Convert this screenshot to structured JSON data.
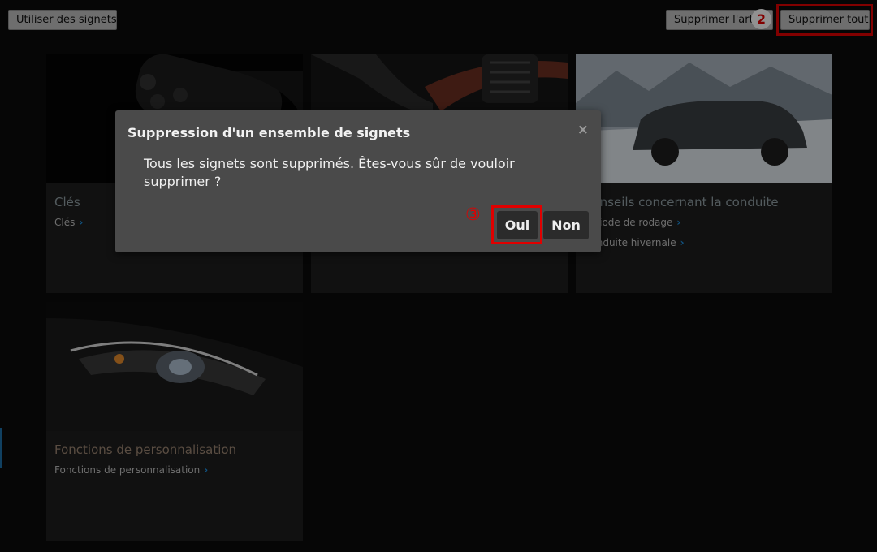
{
  "toolbar": {
    "use_bookmarks": "Utiliser des signets",
    "delete_item": "Supprimer l'article",
    "delete_all": "Supprimer tout"
  },
  "annotations": {
    "step2": "2",
    "step3": "③"
  },
  "cards": [
    {
      "title": "Clés",
      "links": [
        "Clés"
      ]
    },
    {
      "title": "",
      "links": []
    },
    {
      "title": "Conseils concernant la conduite",
      "links": [
        "Période de rodage",
        "Conduite hivernale"
      ]
    },
    {
      "title": "Fonctions de personnalisation",
      "links": [
        "Fonctions de personnalisation"
      ]
    }
  ],
  "dialog": {
    "title": "Suppression d'un ensemble de signets",
    "close_glyph": "×",
    "message": "Tous les signets sont supprimés. Êtes-vous sûr de vouloir supprimer ?",
    "yes_label": "Oui",
    "no_label": "Non"
  },
  "icons": {
    "chevron": "›"
  },
  "colors": {
    "highlight": "#e00000",
    "link_chevron": "#1d8fe0"
  }
}
